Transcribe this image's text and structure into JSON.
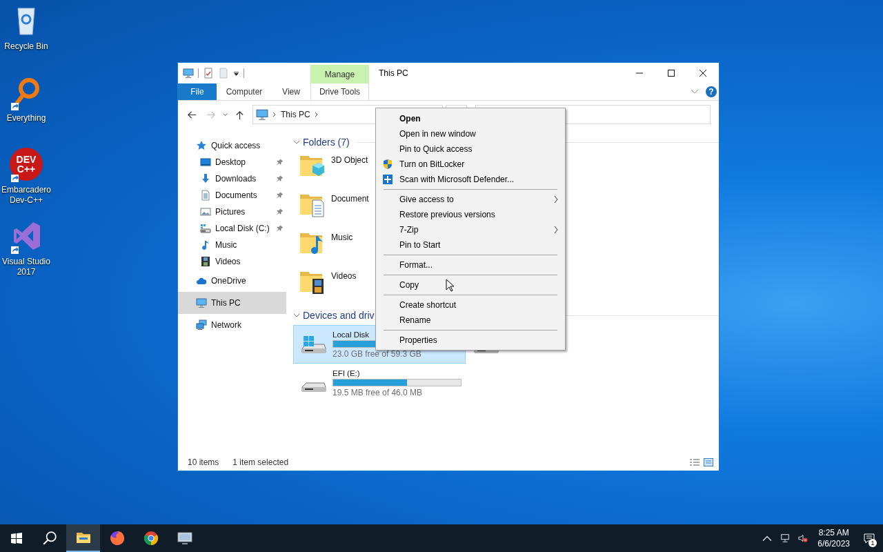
{
  "desktop_icons": [
    {
      "label": "Recycle Bin",
      "kind": "recycle",
      "shortcut": false
    },
    {
      "label": "Everything",
      "kind": "magnifier",
      "shortcut": true
    },
    {
      "label": "Embarcadero Dev-C++",
      "kind": "logo",
      "shortcut": true,
      "logo_lines": [
        "DEV",
        "C++"
      ]
    },
    {
      "label": "Visual Studio 2017",
      "kind": "vs",
      "shortcut": true
    }
  ],
  "window": {
    "title": "This PC",
    "context_group": "Manage",
    "ribbon_tabs": [
      {
        "label": "File",
        "kind": "file",
        "selected": false
      },
      {
        "label": "Computer",
        "kind": "tab",
        "selected": false
      },
      {
        "label": "View",
        "kind": "tab",
        "selected": false
      },
      {
        "label": "Drive Tools",
        "kind": "context",
        "selected": false
      }
    ],
    "help_glyph": "?",
    "address": {
      "path": "This PC"
    },
    "nav_pane": [
      {
        "label": "Quick access",
        "kind": "star",
        "selected": false,
        "children": [
          {
            "label": "Desktop",
            "kind": "desktop",
            "pinned": true,
            "selected": false
          },
          {
            "label": "Downloads",
            "kind": "down",
            "pinned": true,
            "selected": false
          },
          {
            "label": "Documents",
            "kind": "docs",
            "pinned": true,
            "selected": false
          },
          {
            "label": "Pictures",
            "kind": "pics",
            "pinned": true,
            "selected": false
          },
          {
            "label": "Local Disk (C:)",
            "kind": "disk",
            "pinned": true,
            "selected": false
          },
          {
            "label": "Music",
            "kind": "music",
            "pinned": false,
            "selected": false
          },
          {
            "label": "Videos",
            "kind": "video",
            "pinned": false,
            "selected": false
          }
        ]
      },
      {
        "label": "OneDrive",
        "kind": "cloud",
        "selected": false
      },
      {
        "label": "This PC",
        "kind": "pc",
        "selected": true
      },
      {
        "label": "Network",
        "kind": "network",
        "selected": false
      }
    ],
    "folders_header": "Folders (7)",
    "folders": [
      {
        "name": "3D Object",
        "kind": "cube"
      },
      {
        "name": "Document",
        "kind": "doc"
      },
      {
        "name": "Music",
        "kind": "music"
      },
      {
        "name": "Videos",
        "kind": "video"
      }
    ],
    "devices_header": "Devices and driv",
    "drives": [
      {
        "kind": "drive",
        "name": "Local Disk",
        "free": "23.0 GB free of 59.3 GB",
        "level": 0.61,
        "selected": true,
        "system": true
      },
      {
        "kind": "covered"
      },
      {
        "kind": "drive",
        "name": "EFI (E:)",
        "free": "19.5 MB free of 46.0 MB",
        "level": 0.58,
        "selected": false,
        "system": false
      }
    ],
    "status_bar": {
      "items": "10 items",
      "selection": "1 item selected"
    }
  },
  "context_menu": {
    "groups": [
      [
        {
          "label": "Open",
          "bold": true
        },
        {
          "label": "Open in new window"
        },
        {
          "label": "Pin to Quick access"
        },
        {
          "label": "Turn on BitLocker",
          "kind": "shield"
        },
        {
          "label": "Scan with Microsoft Defender...",
          "kind": "defender"
        }
      ],
      [
        {
          "label": "Give access to",
          "submenu": true
        },
        {
          "label": "Restore previous versions"
        },
        {
          "label": "7-Zip",
          "submenu": true
        },
        {
          "label": "Pin to Start"
        }
      ],
      [
        {
          "label": "Format..."
        }
      ],
      [
        {
          "label": "Copy"
        }
      ],
      [
        {
          "label": "Create shortcut"
        },
        {
          "label": "Rename"
        }
      ],
      [
        {
          "label": "Properties"
        }
      ]
    ]
  },
  "taskbar": {
    "apps": [
      {
        "kind": "folder",
        "selected": true
      },
      {
        "kind": "firefox",
        "selected": false
      },
      {
        "kind": "chrome",
        "selected": false
      },
      {
        "kind": "monitor",
        "selected": false
      }
    ],
    "time": "8:25 AM",
    "date": "6/6/2023",
    "notifications": "1"
  }
}
